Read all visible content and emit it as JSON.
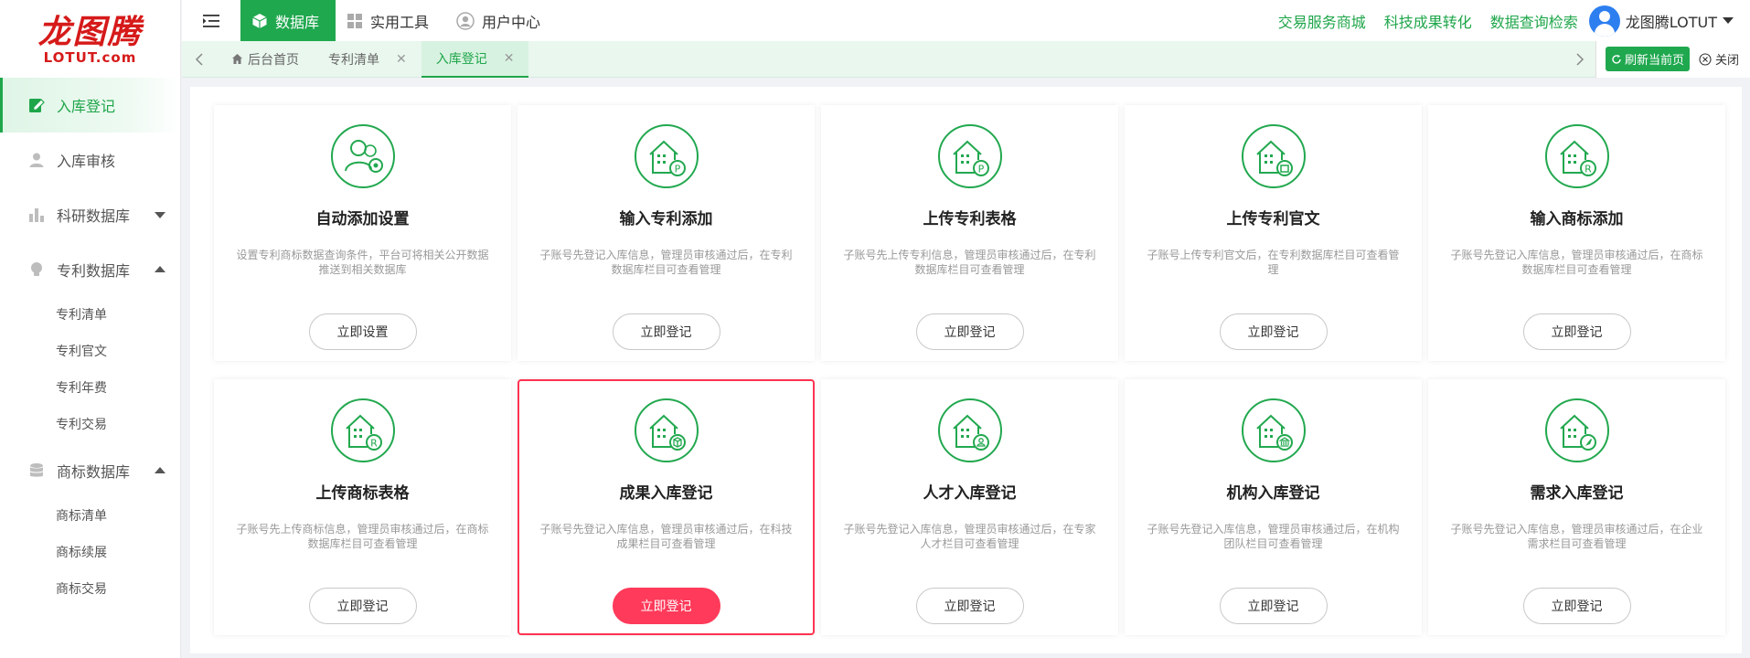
{
  "logo": {
    "main": "龙图腾",
    "sub": "LOTUT.com"
  },
  "sidebar": {
    "items": [
      {
        "label": "入库登记",
        "icon": "edit-register-icon",
        "active": true
      },
      {
        "label": "入库审核",
        "icon": "user-review-icon"
      },
      {
        "label": "科研数据库",
        "icon": "bar-chart-icon",
        "caret": "down"
      },
      {
        "label": "专利数据库",
        "icon": "bulb-icon",
        "caret": "up",
        "children": [
          "专利清单",
          "专利官文",
          "专利年费",
          "专利交易"
        ]
      },
      {
        "label": "商标数据库",
        "icon": "database-icon",
        "caret": "up",
        "children": [
          "商标清单",
          "商标续展",
          "商标交易"
        ]
      }
    ]
  },
  "header": {
    "nav": [
      {
        "label": "数据库",
        "icon": "cube-icon",
        "active": true
      },
      {
        "label": "实用工具",
        "icon": "grid-icon"
      },
      {
        "label": "用户中心",
        "icon": "user-circle-icon"
      }
    ],
    "links": [
      "交易服务商城",
      "科技成果转化",
      "数据查询检索"
    ],
    "username": "龙图腾LOTUT"
  },
  "tabs": {
    "items": [
      {
        "label": "后台首页",
        "home": true
      },
      {
        "label": "专利清单",
        "closable": true
      },
      {
        "label": "入库登记",
        "closable": true,
        "active": true
      }
    ],
    "refresh_label": "刷新当前页",
    "close_label": "关闭"
  },
  "cards": [
    {
      "title": "自动添加设置",
      "desc": "设置专利商标数据查询条件，平台可将相关公开数据推送到相关数据库",
      "button": "立即设置",
      "icon": "user-gear-icon"
    },
    {
      "title": "输入专利添加",
      "desc": "子账号先登记入库信息，管理员审核通过后，在专利数据库栏目可查看管理",
      "button": "立即登记",
      "icon": "building-patent-icon"
    },
    {
      "title": "上传专利表格",
      "desc": "子账号先上传专利信息，管理员审核通过后，在专利数据库栏目可查看管理",
      "button": "立即登记",
      "icon": "building-patent-upload-icon"
    },
    {
      "title": "上传专利官文",
      "desc": "子账号上传专利官文后，在专利数据库栏目可查看管理",
      "button": "立即登记",
      "icon": "building-document-icon"
    },
    {
      "title": "输入商标添加",
      "desc": "子账号先登记入库信息，管理员审核通过后，在商标数据库栏目可查看管理",
      "button": "立即登记",
      "icon": "building-trademark-icon"
    },
    {
      "title": "上传商标表格",
      "desc": "子账号先上传商标信息，管理员审核通过后，在商标数据库栏目可查看管理",
      "button": "立即登记",
      "icon": "building-trademark-upload-icon"
    },
    {
      "title": "成果入库登记",
      "desc": "子账号先登记入库信息，管理员审核通过后，在科技成果栏目可查看管理",
      "button": "立即登记",
      "icon": "building-box-icon",
      "highlight": true
    },
    {
      "title": "人才入库登记",
      "desc": "子账号先登记入库信息，管理员审核通过后，在专家人才栏目可查看管理",
      "button": "立即登记",
      "icon": "building-person-icon"
    },
    {
      "title": "机构入库登记",
      "desc": "子账号先登记入库信息，管理员审核通过后，在机构团队栏目可查看管理",
      "button": "立即登记",
      "icon": "building-institution-icon"
    },
    {
      "title": "需求入库登记",
      "desc": "子账号先登记入库信息，管理员审核通过后，在企业需求栏目可查看管理",
      "button": "立即登记",
      "icon": "building-rocket-icon"
    }
  ],
  "colors": {
    "brand_green": "#20a84f",
    "logo_red": "#d61a1a",
    "primary_button": "#ff3a5a",
    "highlight_border": "#ff3350"
  }
}
